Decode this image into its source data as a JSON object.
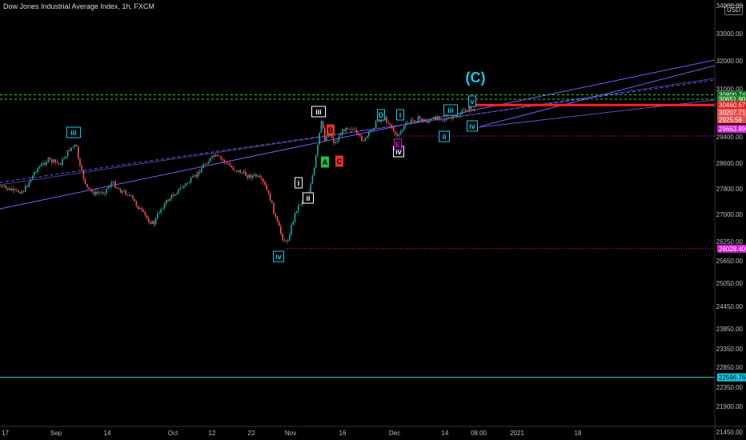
{
  "header": {
    "title": "Dow Jones Industrial Average Index, 1h, FXCM",
    "currency": "USD"
  },
  "chart_data": {
    "type": "candlestick",
    "ylim": [
      21450,
      34000
    ],
    "yticks": [
      "34000.00",
      "33000.00",
      "32000.00",
      "31000.00",
      "29400.00",
      "28600.00",
      "27800.00",
      "27000.00",
      "26250.00",
      "25650.00",
      "25050.00",
      "24450.00",
      "23850.00",
      "23350.00",
      "22850.00",
      "22350.00",
      "21900.00",
      "21450.00"
    ],
    "xticks": [
      {
        "label": "17",
        "x": 0
      },
      {
        "label": "Sep",
        "x": 70
      },
      {
        "label": "14",
        "x": 134
      },
      {
        "label": "Oct",
        "x": 216
      },
      {
        "label": "12",
        "x": 265
      },
      {
        "label": "22",
        "x": 314
      },
      {
        "label": "Nov",
        "x": 363
      },
      {
        "label": "16",
        "x": 428
      },
      {
        "label": "Dec",
        "x": 493
      },
      {
        "label": "14",
        "x": 556
      },
      {
        "label": "08:00",
        "x": 598
      },
      {
        "label": "2021",
        "x": 646
      },
      {
        "label": "18",
        "x": 722
      }
    ],
    "price_labels": [
      {
        "text": "30800.74",
        "value": 30800.74,
        "bg": "#0b6b1e",
        "fg": "#ffffff",
        "line": "#3bd13b",
        "style": "dashed"
      },
      {
        "text": "30651.90",
        "value": 30651.9,
        "bg": "#1f8a2e",
        "fg": "#ffffff",
        "line": "#3bd13b",
        "style": "dashed"
      },
      {
        "text": "30460.67",
        "value": 30460.67,
        "bg": "#e02020",
        "fg": "#ffffff",
        "line": "#ff2020",
        "style": "solid"
      },
      {
        "text": "30207.71",
        "value": 30207.71,
        "bg": "#e85050",
        "fg": "#ffffff"
      },
      {
        "text": "25:58",
        "value": 29980,
        "bg": "#e85050",
        "fg": "#ffffff",
        "prefix": "29"
      },
      {
        "text": "29663.89",
        "value": 29663.89,
        "bg": "#d81bd8",
        "fg": "#ffffff"
      },
      {
        "text": "26028.40",
        "value": 26028.4,
        "bg": "#d81bd8",
        "fg": "#ffffff",
        "line": "#d81bd8",
        "style": "dotted"
      },
      {
        "text": "22596.76",
        "value": 22596.76,
        "bg": "#19c8e8",
        "fg": "#000000",
        "line": "#19c8e8",
        "style": "solid"
      }
    ],
    "big_label": {
      "text": "(C)",
      "color": "#19c8e8"
    },
    "wave_labels": [
      {
        "text": "iii",
        "color": "#19c8e8",
        "style": "box-cyan"
      },
      {
        "text": "iii",
        "color": "#ffffff",
        "style": "box-white"
      },
      {
        "text": "i",
        "color": "#ffffff",
        "style": "box-white"
      },
      {
        "text": "ii",
        "color": "#ffffff",
        "style": "box-white"
      },
      {
        "text": "iv",
        "color": "#19c8e8",
        "style": "box-cyan"
      },
      {
        "text": "A",
        "color": "#1fbf3f",
        "style": "fill-green"
      },
      {
        "text": "B",
        "color": "#e03030",
        "style": "fill-red"
      },
      {
        "text": "C",
        "color": "#e03030",
        "style": "fill-red"
      },
      {
        "text": "D",
        "color": "#19c8e8",
        "style": "box-cyan"
      },
      {
        "text": "iv",
        "color": "#ffffff",
        "style": "box-white"
      },
      {
        "text": "i",
        "color": "#19c8e8",
        "style": "box-cyan"
      },
      {
        "text": "ii",
        "color": "#19c8e8",
        "style": "box-cyan"
      },
      {
        "text": "iii",
        "color": "#19c8e8",
        "style": "box-cyan"
      },
      {
        "text": "iv",
        "color": "#19c8e8",
        "style": "box-cyan"
      },
      {
        "text": "v",
        "color": "#19c8e8",
        "style": "box-cyan"
      },
      {
        "text": "E",
        "color": "#d81bd8",
        "style": "box-magenta"
      }
    ],
    "colors": {
      "up": "#26a69a",
      "down": "#ef5350",
      "channel": "#7a5cff",
      "grid": "#111"
    }
  }
}
